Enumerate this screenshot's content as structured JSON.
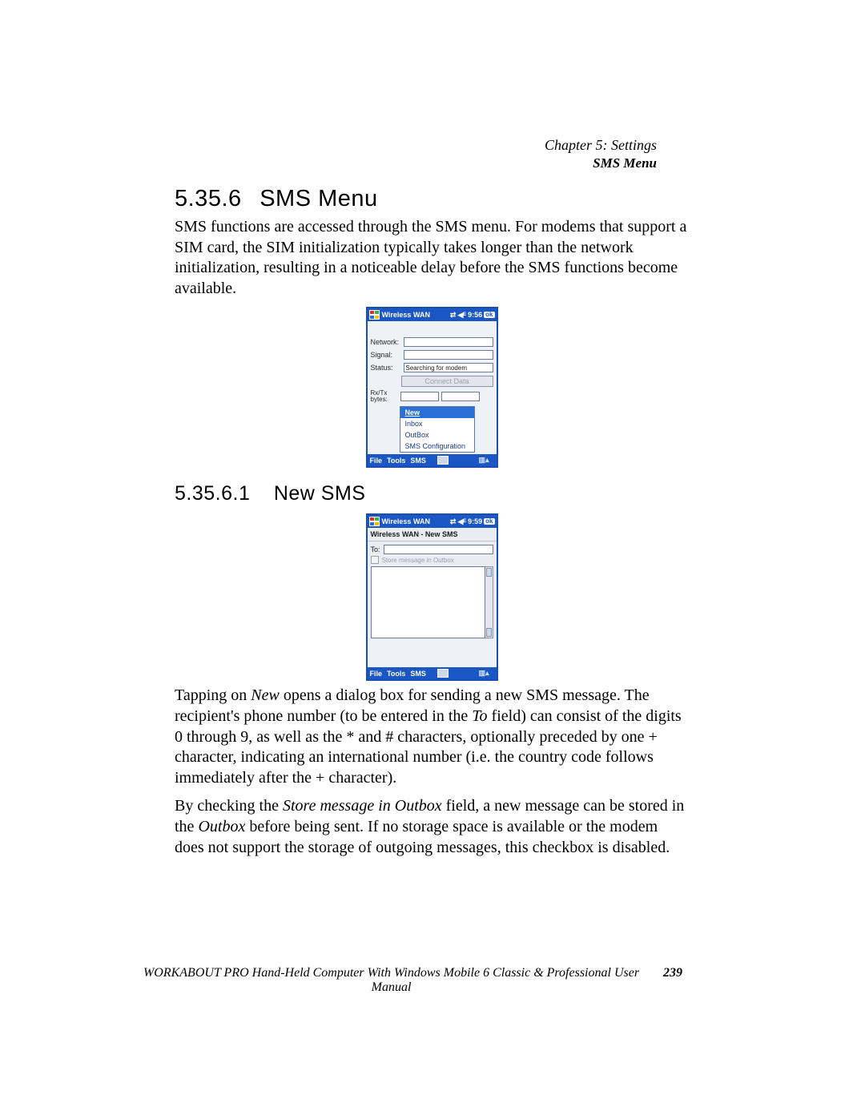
{
  "header": {
    "chapter": "Chapter 5:  Settings",
    "topic": "SMS Menu"
  },
  "section": {
    "number": "5.35.6",
    "title": "SMS Menu"
  },
  "para1": "SMS functions are accessed through the SMS menu. For modems that support a SIM card, the SIM initialization typically takes longer than the network initialization, resulting in a noticeable delay before the SMS functions become available.",
  "shot1": {
    "title": "Wireless WAN",
    "time": "9:56",
    "ok": "ok",
    "labels": {
      "network": "Network:",
      "signal": "Signal:",
      "status": "Status:",
      "rxtx": "Rx/Tx bytes:"
    },
    "values": {
      "network": "",
      "signal": "",
      "status": "Searching for modem",
      "rx": "",
      "tx": ""
    },
    "connect_btn": "Connect Data",
    "menu": {
      "new": "New",
      "inbox": "Inbox",
      "outbox": "OutBox",
      "config": "SMS Configuration"
    },
    "footer": {
      "file": "File",
      "tools": "Tools",
      "sms": "SMS"
    }
  },
  "subsection": {
    "number": "5.35.6.1",
    "title": "New SMS"
  },
  "shot2": {
    "title": "Wireless WAN",
    "time": "9:59",
    "ok": "ok",
    "subtitle": "Wireless WAN - New SMS",
    "to_label": "To:",
    "to_value": "",
    "store_label": "Store message in Outbox",
    "footer": {
      "file": "File",
      "tools": "Tools",
      "sms": "SMS"
    }
  },
  "para2_parts": {
    "a": "Tapping on ",
    "b": "New",
    "c": " opens a dialog box for sending a new SMS message. The recipient's phone number (to be entered in the ",
    "d": "To",
    "e": " field) can consist of the digits 0 through 9, as well as the * and # characters, optionally preceded by one + character, indicating an international number (i.e. the country code follows immediately after the + character)."
  },
  "para3_parts": {
    "a": "By checking the ",
    "b": "Store message in Outbox",
    "c": " field, a new message can be stored in the ",
    "d": "Outbox",
    "e": " before being sent. If no storage space is available or the modem does not support the storage of outgoing messages, this checkbox is disabled."
  },
  "footer": {
    "text": "WORKABOUT PRO Hand-Held Computer With Windows Mobile 6 Classic & Professional User Manual",
    "page": "239"
  }
}
